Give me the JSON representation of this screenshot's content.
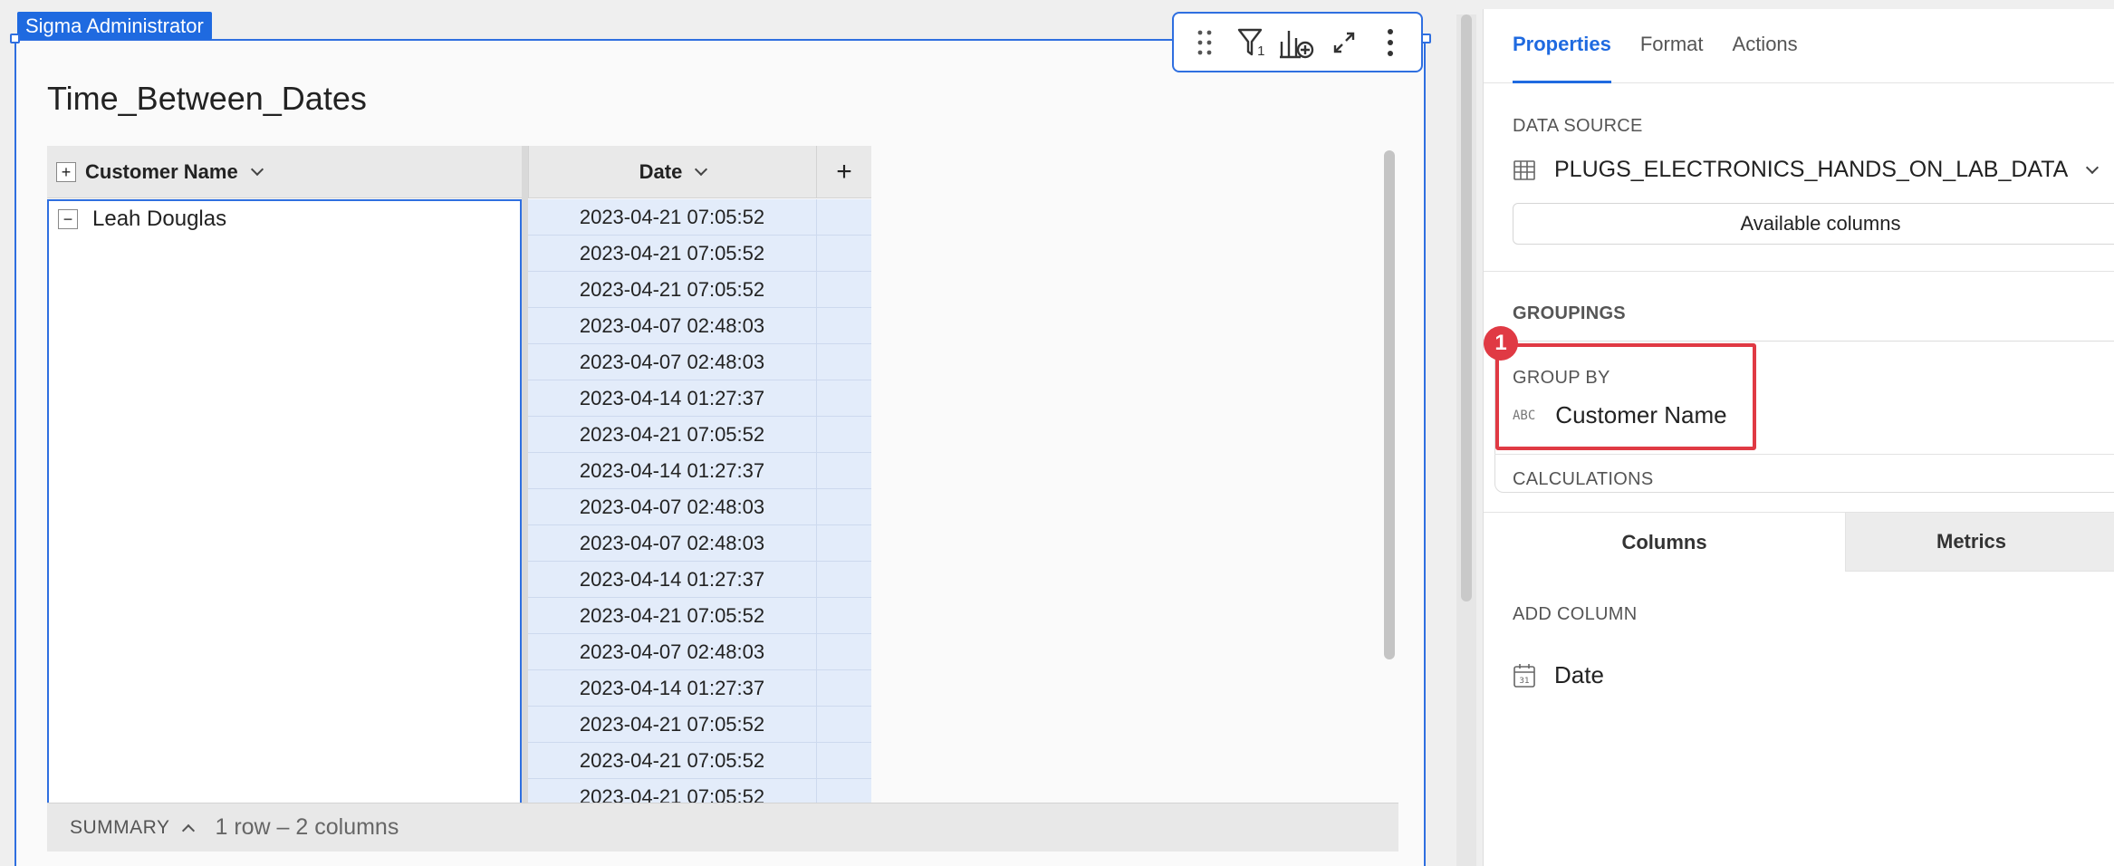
{
  "owner_tag": "Sigma Administrator",
  "element": {
    "title": "Time_Between_Dates",
    "toolbar": {
      "icons": [
        "drag-handle-icon",
        "filter-icon",
        "add-chart-icon",
        "expand-icon",
        "more-icon"
      ],
      "filter_count": "1"
    }
  },
  "table": {
    "columns": [
      "Customer Name",
      "Date",
      "+"
    ],
    "group_value": "Leah Douglas",
    "group_expand": "+",
    "group_collapse": "−",
    "dates": [
      "2023-04-21 07:05:52",
      "2023-04-21 07:05:52",
      "2023-04-21 07:05:52",
      "2023-04-07 02:48:03",
      "2023-04-07 02:48:03",
      "2023-04-14 01:27:37",
      "2023-04-21 07:05:52",
      "2023-04-14 01:27:37",
      "2023-04-07 02:48:03",
      "2023-04-07 02:48:03",
      "2023-04-14 01:27:37",
      "2023-04-21 07:05:52",
      "2023-04-07 02:48:03",
      "2023-04-14 01:27:37",
      "2023-04-21 07:05:52",
      "2023-04-21 07:05:52",
      "2023-04-21 07:05:52"
    ],
    "summary_label": "SUMMARY",
    "summary_info": "1 row – 2 columns"
  },
  "panel": {
    "tabs": [
      "Properties",
      "Format",
      "Actions"
    ],
    "active_tab": "Properties",
    "data_source_title": "DATA SOURCE",
    "data_source_name": "PLUGS_ELECTRONICS_HANDS_ON_LAB_DATA",
    "available_columns": "Available columns",
    "groupings_title": "GROUPINGS",
    "group_by_title": "GROUP BY",
    "group_by_type": "ABC",
    "group_by_field": "Customer Name",
    "calculations_title": "CALCULATIONS",
    "badge": "1",
    "sub_tabs": [
      "Columns",
      "Metrics"
    ],
    "add_column_title": "ADD COLUMN",
    "columns": [
      {
        "name": "Date",
        "icon": "calendar-icon"
      }
    ]
  },
  "colors": {
    "accent": "#1f6ae0",
    "highlight": "#e03a44",
    "selected_cell": "#e3ecfa"
  }
}
